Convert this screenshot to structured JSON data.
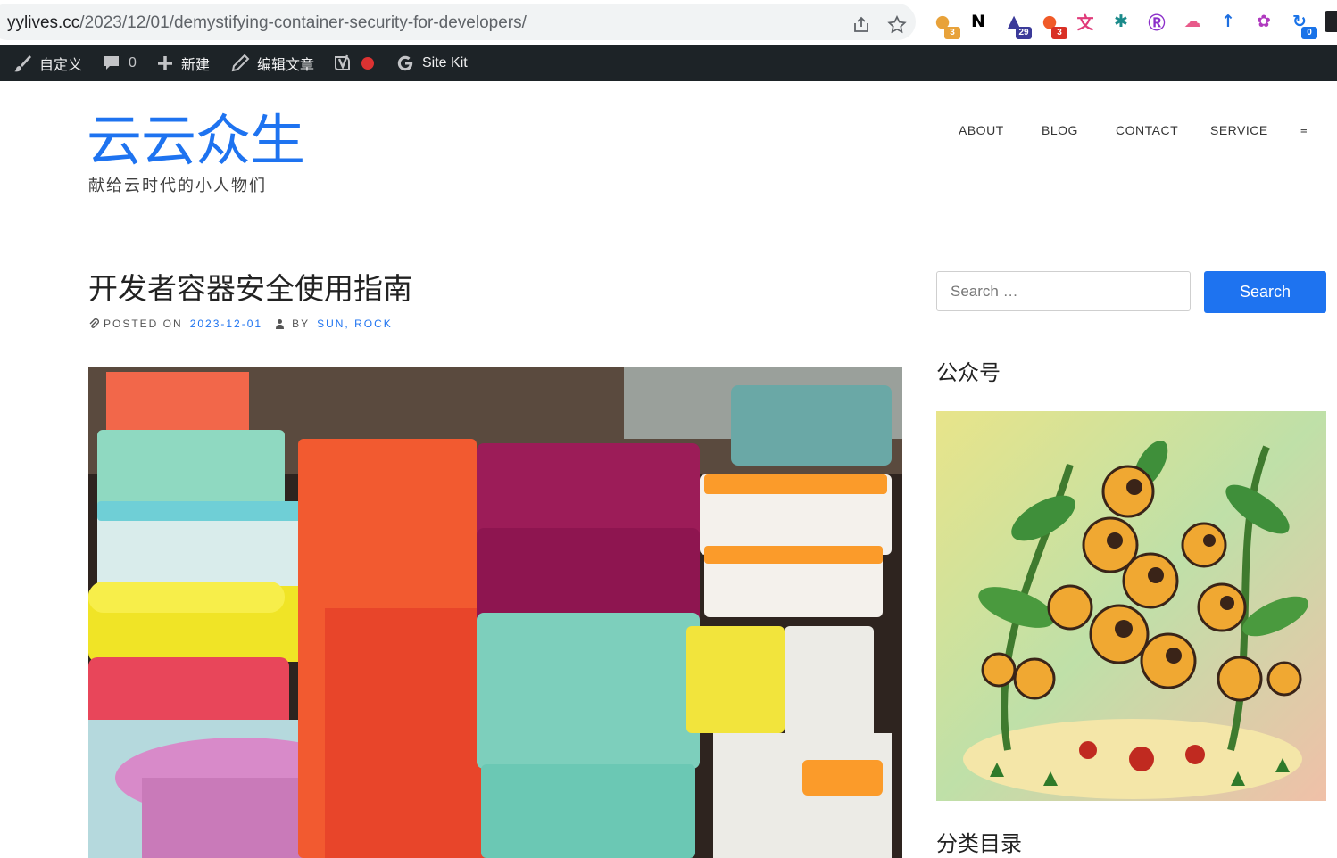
{
  "browser": {
    "url_domain": "yylives.cc",
    "url_path": "/2023/12/01/demystifying-container-security-for-developers/",
    "extensions": [
      {
        "icon": "chatgpt-sidebar-icon",
        "badge": "3",
        "color": "#e8a23a"
      },
      {
        "icon": "notion-icon",
        "badge": "",
        "color": "#000000"
      },
      {
        "icon": "graduation-cap-icon",
        "badge": "29",
        "color": "#3b3a99"
      },
      {
        "icon": "fruit-icon",
        "badge": "3",
        "color": "#f05a28"
      },
      {
        "icon": "translate-icon",
        "badge": "",
        "color": "#e03b7a"
      },
      {
        "icon": "grid-extension-icon",
        "badge": "",
        "color": "#1a8a8a"
      },
      {
        "icon": "lr-icon",
        "badge": "",
        "color": "#8b2fc9"
      },
      {
        "icon": "cloud-icon",
        "badge": "",
        "color": "#e85a8a"
      },
      {
        "icon": "arrow-extension-icon",
        "badge": "",
        "color": "#1e6fe0"
      },
      {
        "icon": "openai-icon",
        "badge": "",
        "color": "#b03abf"
      },
      {
        "icon": "sync-icon",
        "badge": "0",
        "color": "#1a73e8"
      }
    ]
  },
  "admin_bar": {
    "customize": "自定义",
    "comments_count": "0",
    "new": "新建",
    "edit_post": "编辑文章",
    "site_kit": "Site Kit"
  },
  "site": {
    "title": "云云众生",
    "description": "献给云时代的小人物们"
  },
  "nav": [
    "ABOUT",
    "BLOG",
    "CONTACT",
    "SERVICE",
    "≡"
  ],
  "post": {
    "title": "开发者容器安全使用指南",
    "posted_on_label": "POSTED ON",
    "date": "2023-12-01",
    "by_label": "BY",
    "author": "SUN, ROCK"
  },
  "sidebar": {
    "search_placeholder": "Search …",
    "search_button": "Search",
    "widget1_title": "公众号",
    "widget2_title": "分类目录"
  }
}
